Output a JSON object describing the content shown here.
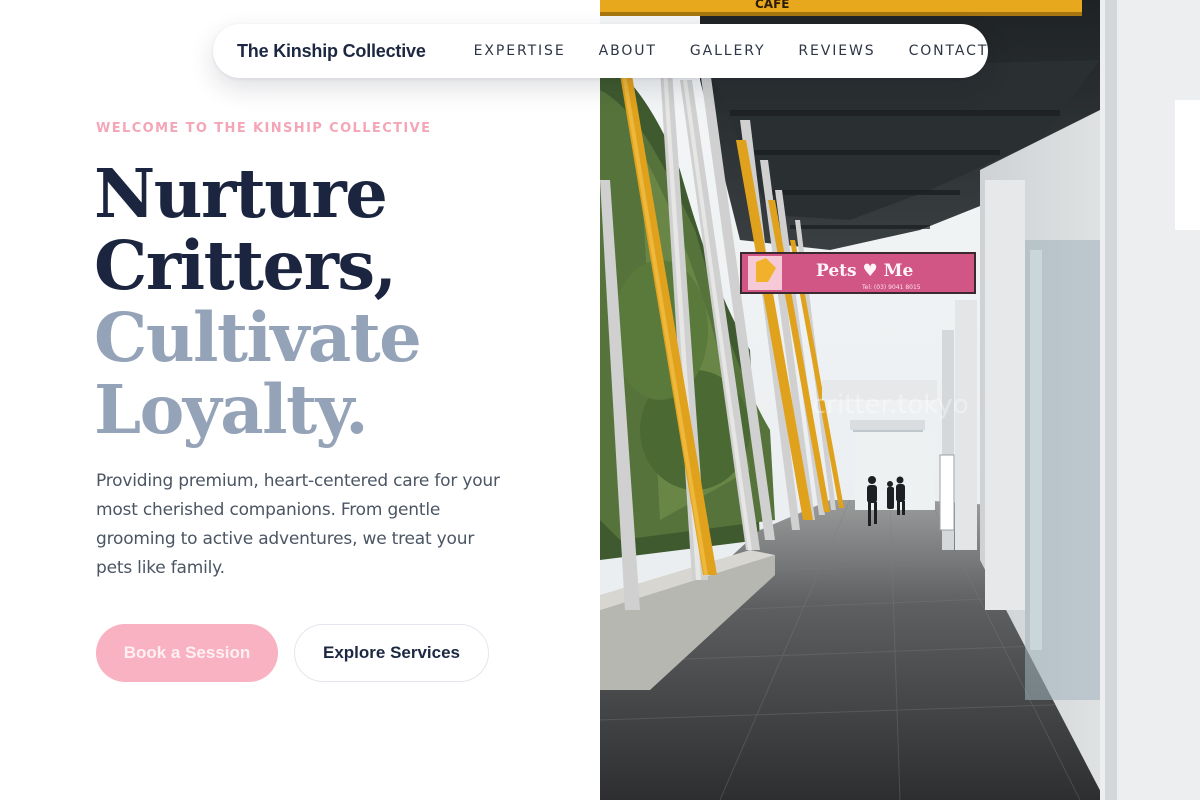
{
  "brand": {
    "name": "The Kinship Collective"
  },
  "nav": {
    "items": [
      {
        "label": "EXPERTISE"
      },
      {
        "label": "ABOUT"
      },
      {
        "label": "GALLERY"
      },
      {
        "label": "REVIEWS"
      },
      {
        "label": "CONTACT"
      }
    ]
  },
  "hero": {
    "eyebrow": "WELCOME TO THE KINSHIP COLLECTIVE",
    "headline": {
      "line1": "Nurture",
      "line2": "Critters,",
      "line3": "Cultivate",
      "line4": "Loyalty."
    },
    "description": "Providing premium, heart-centered care for your most cherished companions. From gentle grooming to active adventures, we treat your pets like family.",
    "primary_cta": "Book a Session",
    "secondary_cta": "Explore Services"
  },
  "photo": {
    "storefront_sign": "Pets ♥ Me",
    "sign_phone": "Tel: (03) 9041 8015",
    "top_sign": "CAFE",
    "watermark": "critter.tokyo"
  },
  "colors": {
    "accent_pink": "#f4a6b7",
    "primary_button": "#f9b2c1",
    "heading_dark": "#1b2540",
    "heading_muted": "#94a3b8",
    "body_text": "#4b5563"
  }
}
